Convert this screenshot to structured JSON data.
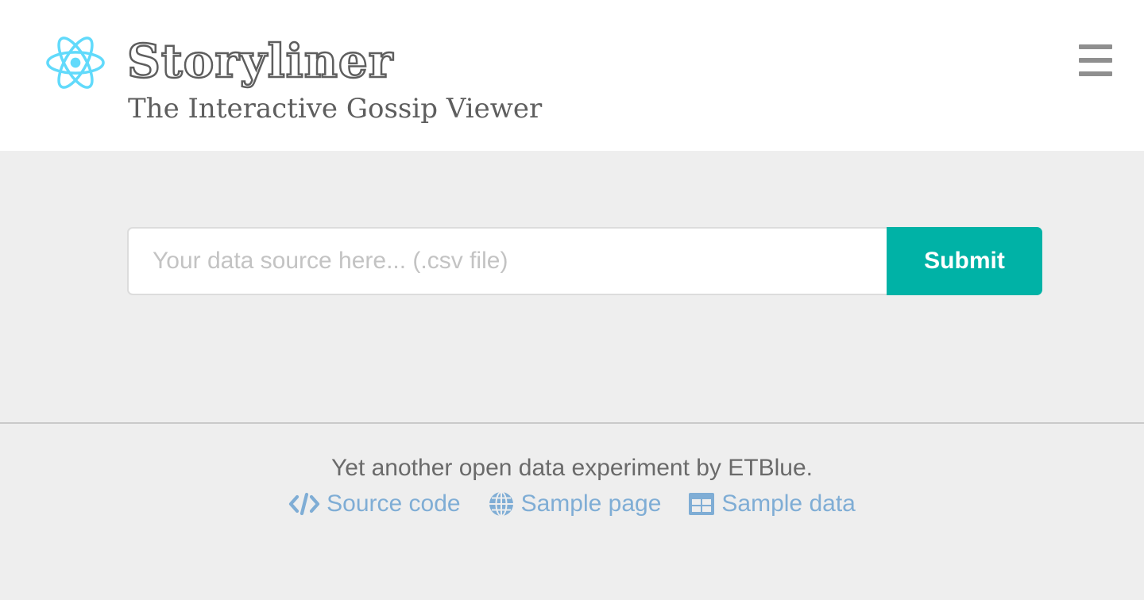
{
  "header": {
    "title": "Storyliner",
    "subtitle": "The Interactive Gossip Viewer",
    "logo_icon": "react-atom-icon",
    "menu_icon": "hamburger-menu-icon"
  },
  "form": {
    "input_value": "",
    "input_placeholder": "Your data source here... (.csv file)",
    "submit_label": "Submit"
  },
  "footer": {
    "text": "Yet another open data experiment by ETBlue.",
    "links": [
      {
        "label": "Source code",
        "icon": "code-icon"
      },
      {
        "label": "Sample page",
        "icon": "globe-icon"
      },
      {
        "label": "Sample data",
        "icon": "table-icon"
      }
    ]
  },
  "colors": {
    "accent": "#00b2a6",
    "logo": "#61dafb",
    "link": "#7fadd5",
    "text": "#5e5e5e",
    "background": "#eeeeee"
  }
}
